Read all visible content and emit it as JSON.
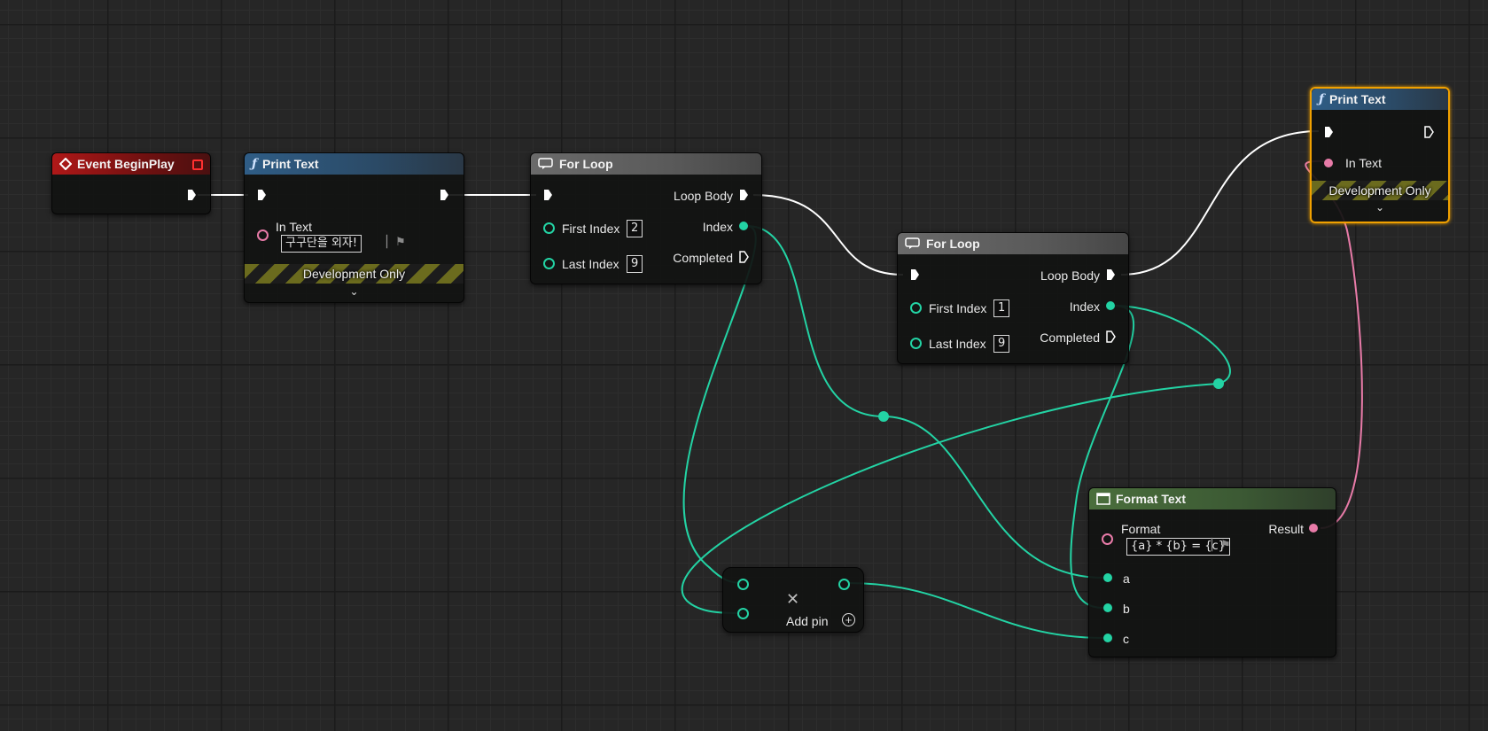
{
  "colors": {
    "exec": "#ffffff",
    "integer_pin": "#23d3a4",
    "text_pin": "#e87ba8",
    "selection": "#f0a000"
  },
  "icons": {
    "event": "event-diamond-icon",
    "function": "function-f-icon",
    "macro": "loop-macro-icon",
    "format": "format-text-icon",
    "flag": "flag-icon",
    "add": "plus-circle-icon",
    "remove": "x-remove-icon",
    "expand": "chevron-down-icon"
  },
  "nodes": {
    "begin_play": {
      "title": "Event BeginPlay"
    },
    "print_text_1": {
      "title": "Print Text",
      "in_text_label": "In Text",
      "in_text_value": "구구단을 외자!",
      "dev_only": "Development Only"
    },
    "for_loop_1": {
      "title": "For Loop",
      "first_index_label": "First Index",
      "first_index_value": "2",
      "last_index_label": "Last Index",
      "last_index_value": "9",
      "loop_body_label": "Loop Body",
      "index_label": "Index",
      "completed_label": "Completed"
    },
    "for_loop_2": {
      "title": "For Loop",
      "first_index_label": "First Index",
      "first_index_value": "1",
      "last_index_label": "Last Index",
      "last_index_value": "9",
      "loop_body_label": "Loop Body",
      "index_label": "Index",
      "completed_label": "Completed"
    },
    "print_text_2": {
      "title": "Print Text",
      "in_text_label": "In Text",
      "dev_only": "Development Only"
    },
    "multiply": {
      "remove_symbol": "✕",
      "add_pin_label": "Add pin"
    },
    "format_text": {
      "title": "Format Text",
      "format_label": "Format",
      "format_value": "{a} * {b} = {c}",
      "result_label": "Result",
      "a_label": "a",
      "b_label": "b",
      "c_label": "c"
    }
  }
}
